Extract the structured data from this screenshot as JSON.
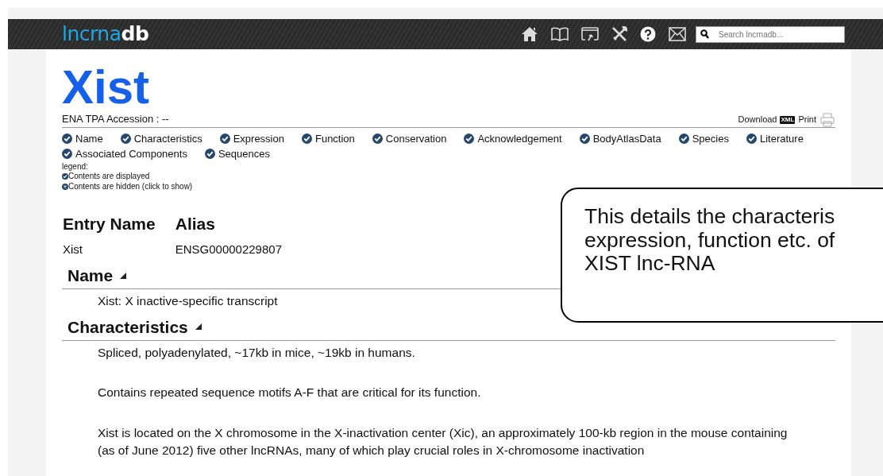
{
  "header": {
    "logo_light": "lncrna",
    "logo_bold": "db",
    "search": {
      "placeholder": "Search lncrnadb..."
    }
  },
  "entry": {
    "title": "Xist",
    "accession": "ENA TPA Accession : --",
    "download": "Download",
    "xml_badge": "XML",
    "print": "Print"
  },
  "section_toggles": [
    {
      "label": "Name",
      "shown": true
    },
    {
      "label": "Characteristics",
      "shown": true
    },
    {
      "label": "Expression",
      "shown": true
    },
    {
      "label": "Function",
      "shown": true
    },
    {
      "label": "Conservation",
      "shown": true
    },
    {
      "label": "Acknowledgement",
      "shown": true
    },
    {
      "label": "BodyAtlasData",
      "shown": true
    },
    {
      "label": "Species",
      "shown": true
    },
    {
      "label": "Literature",
      "shown": true
    },
    {
      "label": "Associated Components",
      "shown": true
    },
    {
      "label": "Sequences",
      "shown": true
    }
  ],
  "legend": {
    "title": "legend:",
    "items": [
      {
        "kind": "shown",
        "label": "Contents are displayed"
      },
      {
        "kind": "hidden",
        "label": "Contents are hidden (click to show)"
      }
    ]
  },
  "names_table": {
    "columns": [
      "Entry Name",
      "Alias"
    ],
    "rows": [
      [
        "Xist",
        "ENSG00000229807"
      ]
    ]
  },
  "sections": [
    {
      "title": "Name",
      "expanded": true,
      "paragraphs": [
        "Xist: X inactive-specific transcript"
      ]
    },
    {
      "title": "Characteristics",
      "expanded": true,
      "paragraphs": [
        "Spliced, polyadenylated, ~17kb in mice, ~19kb in humans.",
        "Contains repeated sequence motifs A-F that are critical for its function.",
        "Xist is located on the X chromosome in the X-inactivation center (Xic), an approximately 100-kb region in the mouse containing (as of June 2012) five other lncRNAs, many of which play crucial roles in X-chromosome inactivation"
      ]
    }
  ],
  "callout": {
    "lines": [
      "This details the characteris",
      "expression, function etc. of",
      "XIST lnc-RNA"
    ]
  }
}
